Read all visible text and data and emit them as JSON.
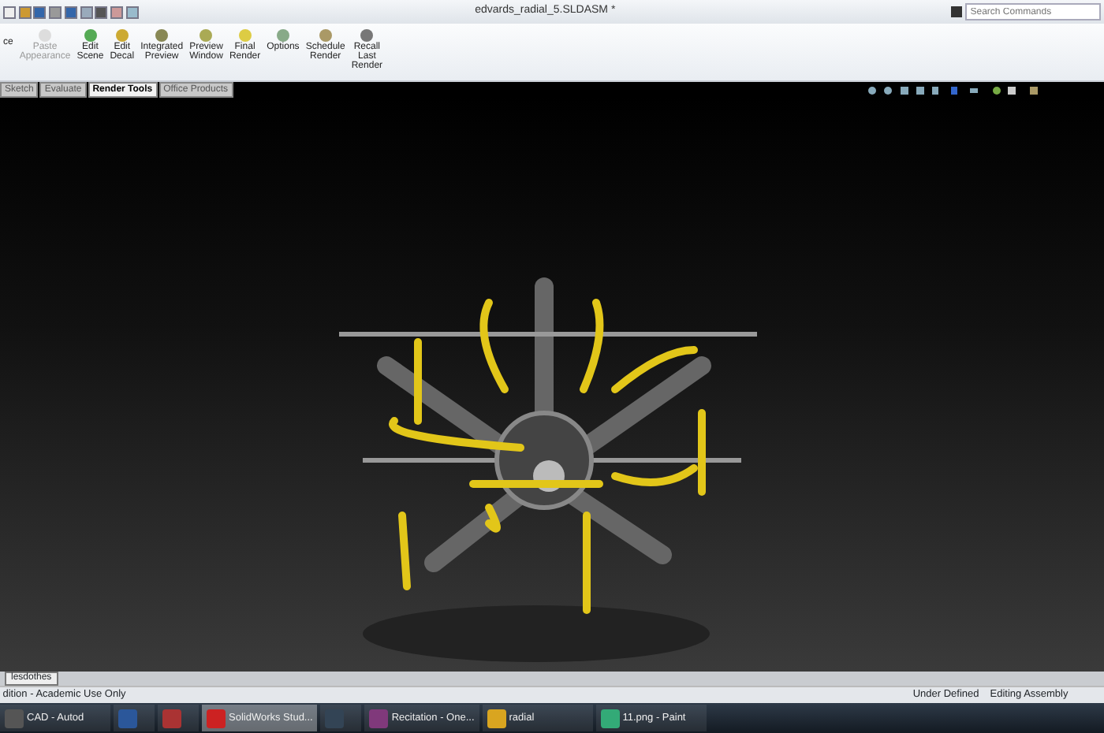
{
  "window": {
    "title": "edvards_radial_5.SLDASM *"
  },
  "search": {
    "placeholder": "Search Commands"
  },
  "ribbon": {
    "cut_label": "ce",
    "items": [
      {
        "label": "Paste Appearance",
        "disabled": true
      },
      {
        "label": "Edit Scene",
        "disabled": false
      },
      {
        "label": "Edit Decal",
        "disabled": false
      },
      {
        "label": "Integrated Preview",
        "disabled": false
      },
      {
        "label": "Preview Window",
        "disabled": false
      },
      {
        "label": "Final Render",
        "disabled": false
      },
      {
        "label": "Options",
        "disabled": false
      },
      {
        "label": "Schedule Render",
        "disabled": false
      },
      {
        "label": "Recall Last Render",
        "disabled": false
      }
    ]
  },
  "tabs": [
    {
      "label": "Sketch",
      "selected": false
    },
    {
      "label": "Evaluate",
      "selected": false
    },
    {
      "label": "Render Tools",
      "selected": true
    },
    {
      "label": "Office Products",
      "selected": false
    }
  ],
  "model_tabs": [
    {
      "label": "lesdothes"
    }
  ],
  "status_bar": {
    "left": "dition - Academic Use Only",
    "right": [
      "Under Defined",
      "Editing Assembly"
    ]
  },
  "taskbar": [
    {
      "label": "CAD - Autod",
      "selected": false
    },
    {
      "selected": false
    },
    {
      "selected": false
    },
    {
      "label": "SolidWorks Stud...",
      "selected": true
    },
    {
      "selected": false
    },
    {
      "label": "Recitation - One...",
      "selected": false
    },
    {
      "label": "radial",
      "selected": false
    },
    {
      "label": "11.png - Paint",
      "selected": false
    }
  ]
}
